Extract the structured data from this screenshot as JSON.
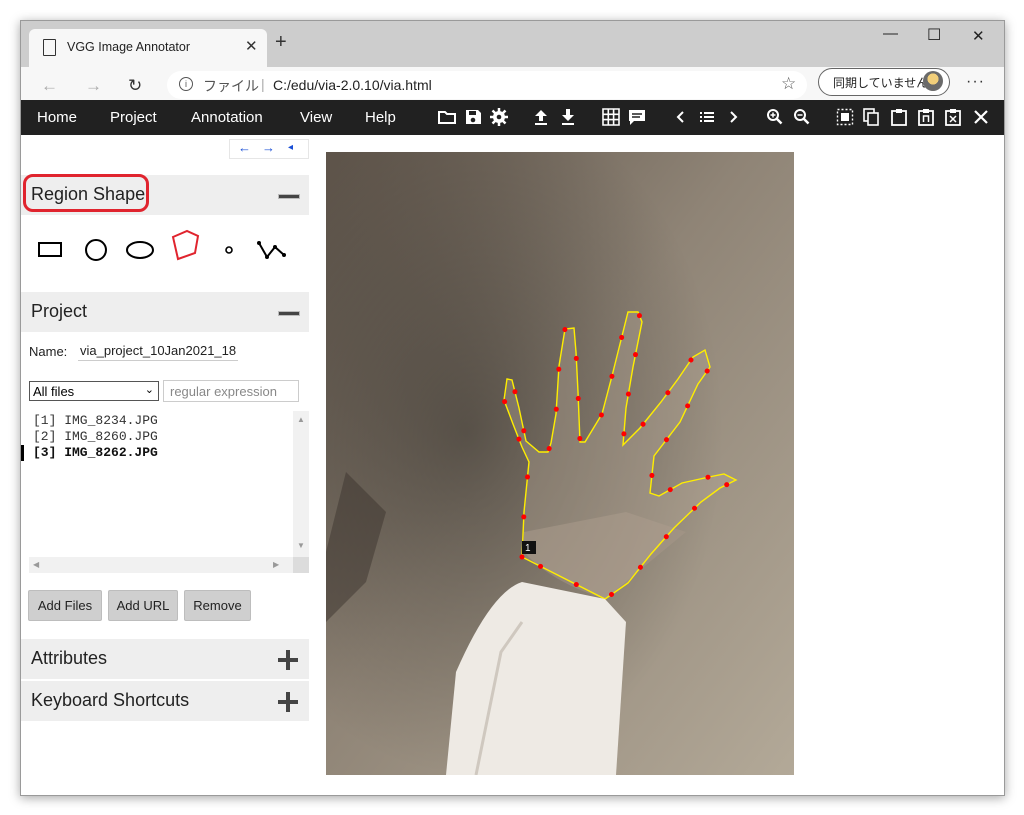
{
  "browser": {
    "tab_title": "VGG Image Annotator",
    "url_label": "ファイル",
    "url": "C:/edu/via-2.0.10/via.html",
    "sync_label": "同期していません"
  },
  "menu": [
    "Home",
    "Project",
    "Annotation",
    "View",
    "Help"
  ],
  "toolbar_icons": [
    "folder-open-icon",
    "save-icon",
    "settings-icon",
    "upload-icon",
    "download-icon",
    "grid-view-icon",
    "comment-icon",
    "previous-icon",
    "list-icon",
    "next-icon",
    "zoom-in-icon",
    "zoom-out-icon",
    "select-all-icon",
    "copy-icon",
    "paste-icon",
    "paste-n-icon",
    "paste-undo-icon",
    "delete-icon"
  ],
  "sidebar": {
    "region_shape": {
      "title": "Region Shape",
      "shapes": [
        "rectangle",
        "circle",
        "ellipse",
        "polygon",
        "point",
        "polyline"
      ],
      "selected": "polygon"
    },
    "project": {
      "title": "Project",
      "name_label": "Name:",
      "name_value": "via_project_10Jan2021_18",
      "filter_selected": "All files",
      "regex_placeholder": "regular expression",
      "files": [
        "[1] IMG_8234.JPG",
        "[2] IMG_8260.JPG",
        "[3] IMG_8262.JPG"
      ],
      "current_index": 2,
      "buttons": {
        "add_files": "Add Files",
        "add_url": "Add URL",
        "remove": "Remove"
      }
    },
    "attributes_title": "Attributes",
    "shortcuts_title": "Keyboard Shortcuts"
  },
  "annotation": {
    "region_id": "1",
    "highlight_color": "#e0242e",
    "polygon_stroke": "#ffee00",
    "vertex_color": "#ff0000"
  }
}
